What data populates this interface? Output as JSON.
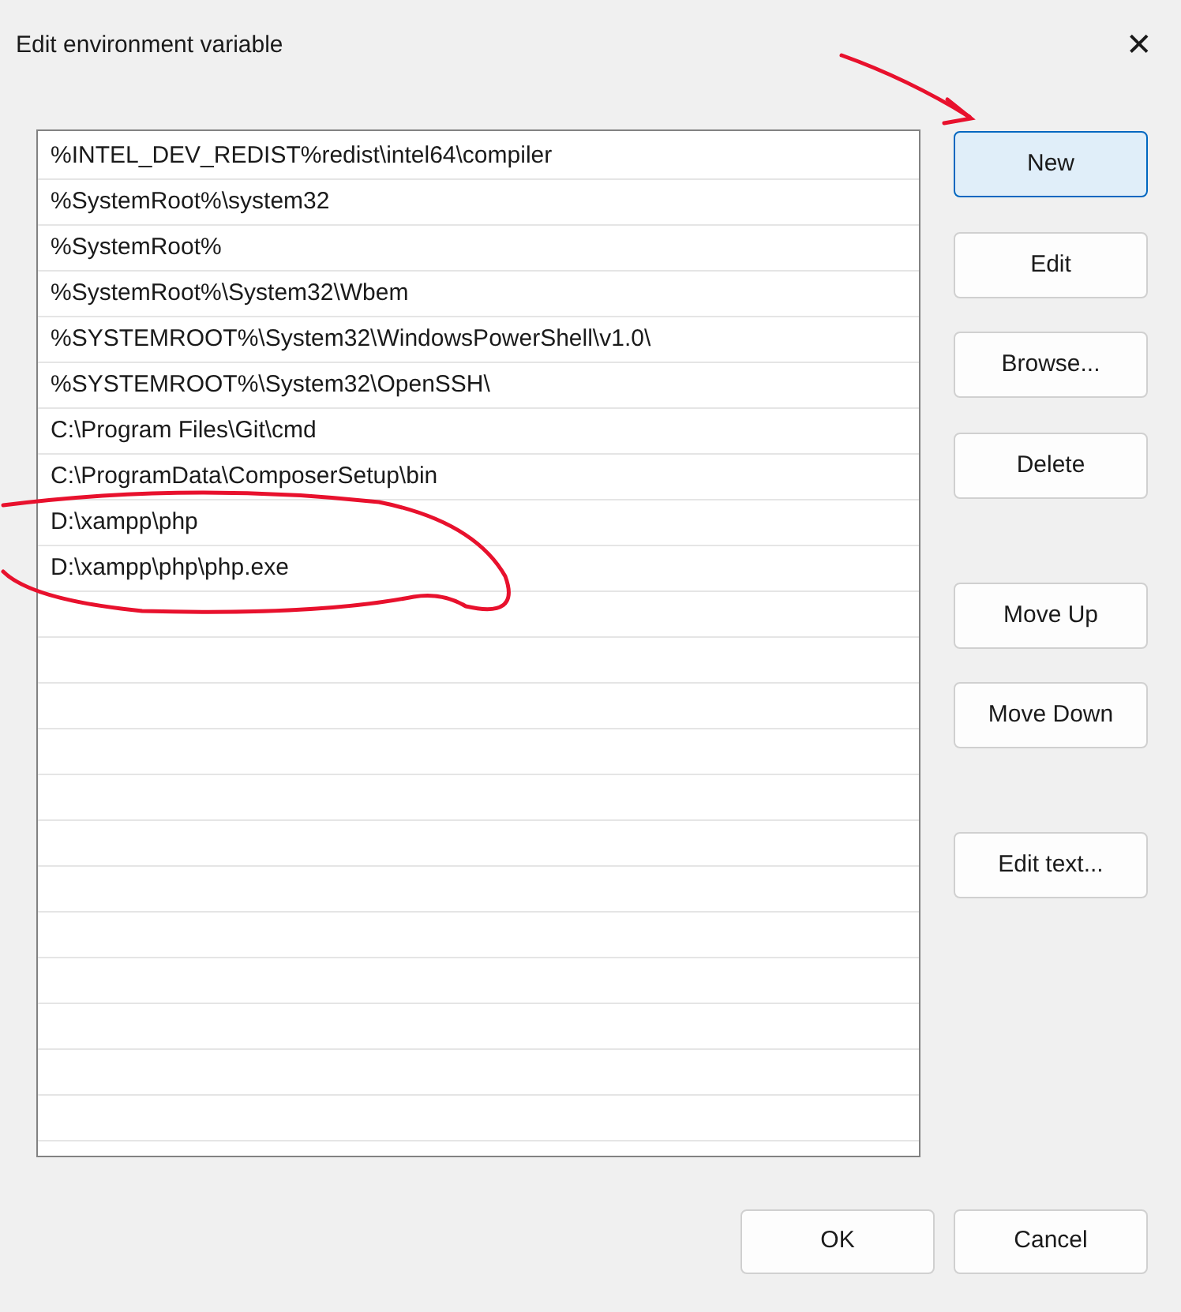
{
  "window": {
    "title": "Edit environment variable",
    "close": "✕"
  },
  "paths": [
    {
      "text": "%INTEL_DEV_REDIST%redist\\intel64\\compiler"
    },
    {
      "text": "%SystemRoot%\\system32"
    },
    {
      "text": "%SystemRoot%"
    },
    {
      "text": "%SystemRoot%\\System32\\Wbem"
    },
    {
      "text": "%SYSTEMROOT%\\System32\\WindowsPowerShell\\v1.0\\"
    },
    {
      "text": "%SYSTEMROOT%\\System32\\OpenSSH\\"
    },
    {
      "text": "C:\\Program Files\\Git\\cmd"
    },
    {
      "text": "C:\\ProgramData\\ComposerSetup\\bin"
    },
    {
      "text": "D:\\xampp\\php"
    },
    {
      "text": "D:\\xampp\\php\\php.exe"
    }
  ],
  "side_buttons": [
    {
      "label": "New",
      "focused": true
    },
    {
      "label": "Edit",
      "focused": false
    },
    {
      "label": "Browse...",
      "focused": false
    },
    {
      "label": "Delete",
      "focused": false
    },
    {
      "label": "Move Up",
      "focused": false
    },
    {
      "label": "Move Down",
      "focused": false
    },
    {
      "label": "Edit text...",
      "focused": false
    }
  ],
  "footer_buttons": [
    {
      "label": "OK"
    },
    {
      "label": "Cancel"
    }
  ]
}
